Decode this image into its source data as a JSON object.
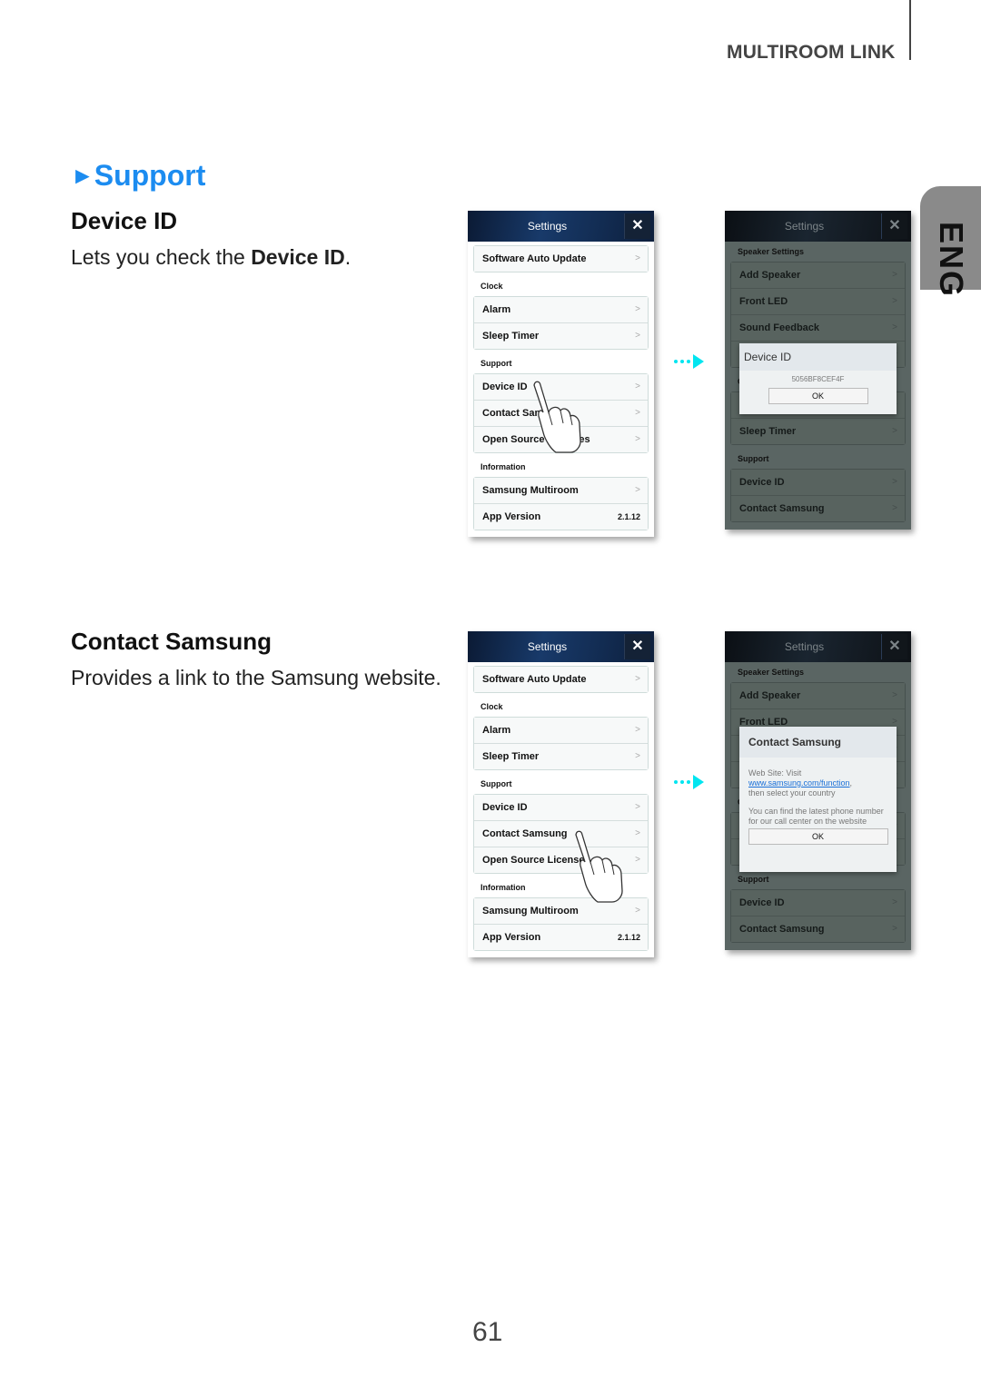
{
  "header": {
    "section": "MULTIROOM LINK",
    "language_tab": "ENG"
  },
  "section": {
    "marker": "►",
    "title": "Support"
  },
  "topics": [
    {
      "title": "Device ID",
      "desc_prefix": "Lets you check the ",
      "desc_bold": "Device ID",
      "desc_suffix": "."
    },
    {
      "title": "Contact Samsung",
      "desc": "Provides a link to the Samsung website."
    }
  ],
  "settings_screen": {
    "title": "Settings",
    "close_icon": "close-icon",
    "groups_light": [
      {
        "label": "",
        "items": [
          {
            "label": "Software Auto Update",
            "chevron": ">"
          }
        ]
      },
      {
        "label": "Clock",
        "items": [
          {
            "label": "Alarm",
            "chevron": ">"
          },
          {
            "label": "Sleep Timer",
            "chevron": ">"
          }
        ]
      },
      {
        "label": "Support",
        "items": [
          {
            "label": "Device ID",
            "chevron": ">"
          },
          {
            "label": "Contact Samsung",
            "chevron": ">"
          },
          {
            "label": "Open Source Licenses",
            "chevron": ">"
          }
        ]
      },
      {
        "label": "Information",
        "items": [
          {
            "label": "Samsung Multiroom",
            "chevron": ">"
          },
          {
            "label": "App Version",
            "value": "2.1.12"
          }
        ]
      }
    ],
    "groups_dark": [
      {
        "label": "Speaker Settings",
        "items": [
          {
            "label": "Add Speaker",
            "chevron": ">"
          },
          {
            "label": "Front LED",
            "chevron": ">"
          },
          {
            "label": "Sound Feedback",
            "chevron": ">"
          },
          {
            "label": "",
            "chevron": ">"
          }
        ]
      },
      {
        "label": "Clock",
        "items": [
          {
            "label": "Alarm",
            "chevron": ">"
          },
          {
            "label": "Sleep Timer",
            "chevron": ">"
          }
        ]
      },
      {
        "label": "Support",
        "items": [
          {
            "label": "Device ID",
            "chevron": ">"
          },
          {
            "label": "Contact Samsung",
            "chevron": ">"
          }
        ]
      }
    ]
  },
  "device_id_dialog": {
    "title": "Device ID",
    "value": "5056BF8CEF4F",
    "ok": "OK"
  },
  "contact_dialog": {
    "title": "Contact Samsung",
    "line1": "Web Site: Visit",
    "link": "www.samsung.com/function",
    "line1_after": ",",
    "line2": "then select your country",
    "para2": "You can find the latest phone number for our call center on the website",
    "ok": "OK"
  },
  "page_number": "61",
  "colors": {
    "accent": "#1c8cf0",
    "arrow": "#00e5f0",
    "tab": "#8a8a8a"
  }
}
